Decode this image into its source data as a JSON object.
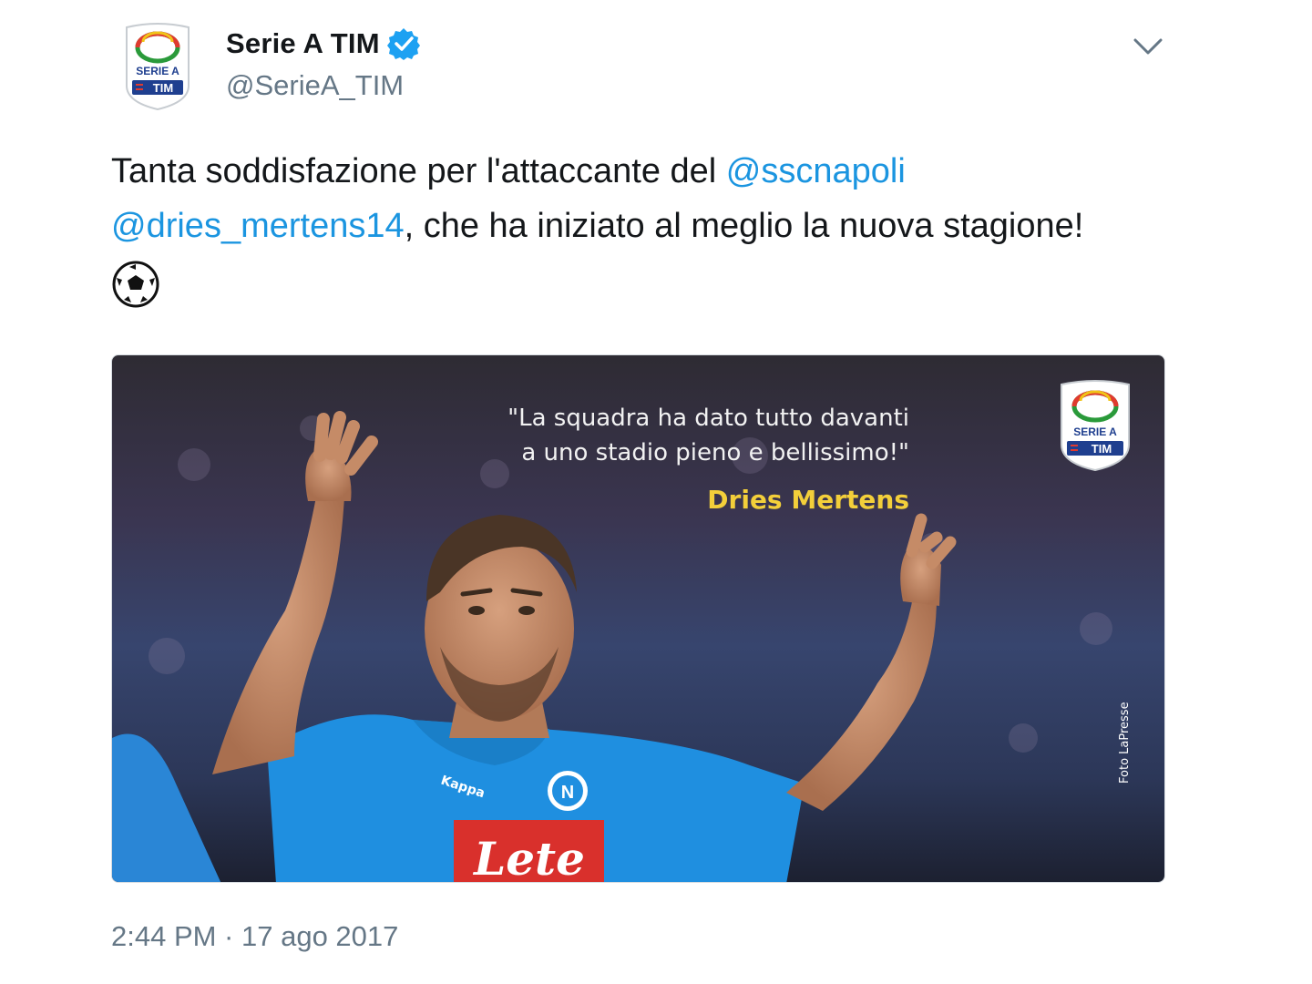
{
  "author": {
    "display_name": "Serie A TIM",
    "handle": "@SerieA_TIM",
    "verified": true,
    "avatar_text_top": "SERIE A",
    "avatar_text_bottom": "TIM"
  },
  "tweet": {
    "text_before": "Tanta soddisfazione per l'attaccante del ",
    "mention_1": "@sscnapoli",
    "mention_2": "@dries_mertens14",
    "text_after": ", che ha iniziato al meglio la nuova stagione!",
    "emoji": "soccer-ball"
  },
  "media": {
    "quote_line1": "\"La squadra ha dato tutto davanti",
    "quote_line2": "a uno stadio pieno e bellissimo!\"",
    "quote_author": "Dries Mertens",
    "photo_credit": "Foto LaPresse",
    "logo_text_top": "SERIE A",
    "logo_text_bottom": "TIM",
    "shirt_sponsor": "Lete",
    "shirt_brand": "Kappa"
  },
  "timestamp": "2:44 PM · 17 ago 2017",
  "colors": {
    "mention": "#1b95e0",
    "secondary_text": "#657786",
    "verified_badge": "#1da1f2",
    "quote_author": "#f3cf3a",
    "napoli_blue": "#1f8fe0"
  },
  "icons": [
    "verified-badge-icon",
    "chevron-down-icon",
    "soccer-ball-icon"
  ]
}
